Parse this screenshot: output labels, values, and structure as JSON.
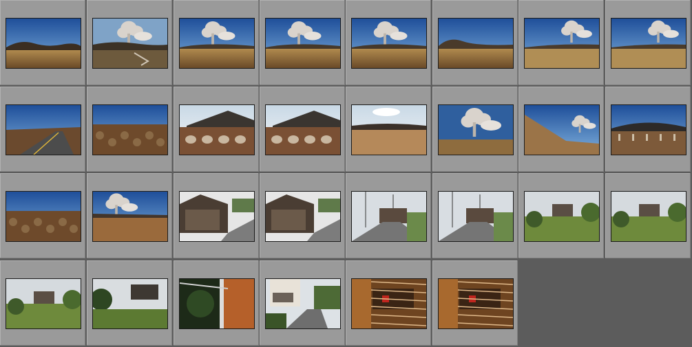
{
  "app": {
    "view": "grid",
    "thumbnail_count": 30,
    "columns": 8
  },
  "colors": {
    "cell_bg": "#9a9a9a",
    "empty_bg": "#5c5c5c"
  },
  "thumbnails": [
    {
      "scene": "landscape"
    },
    {
      "scene": "eruption-left"
    },
    {
      "scene": "eruption-center"
    },
    {
      "scene": "eruption-center"
    },
    {
      "scene": "eruption-center"
    },
    {
      "scene": "landscape-hill"
    },
    {
      "scene": "eruption-right"
    },
    {
      "scene": "eruption-right"
    },
    {
      "scene": "road"
    },
    {
      "scene": "brush-field"
    },
    {
      "scene": "mountain-brush"
    },
    {
      "scene": "mountain-brush"
    },
    {
      "scene": "grass-sky"
    },
    {
      "scene": "eruption-close"
    },
    {
      "scene": "slope-eruption"
    },
    {
      "scene": "mountain-grass"
    },
    {
      "scene": "brush-field"
    },
    {
      "scene": "eruption-brush"
    },
    {
      "scene": "old-house"
    },
    {
      "scene": "old-house"
    },
    {
      "scene": "street"
    },
    {
      "scene": "street"
    },
    {
      "scene": "village-green"
    },
    {
      "scene": "village-green"
    },
    {
      "scene": "village-green"
    },
    {
      "scene": "house-trees"
    },
    {
      "scene": "window-wood"
    },
    {
      "scene": "house-alley"
    },
    {
      "scene": "wood-interior"
    },
    {
      "scene": "wood-interior"
    }
  ]
}
